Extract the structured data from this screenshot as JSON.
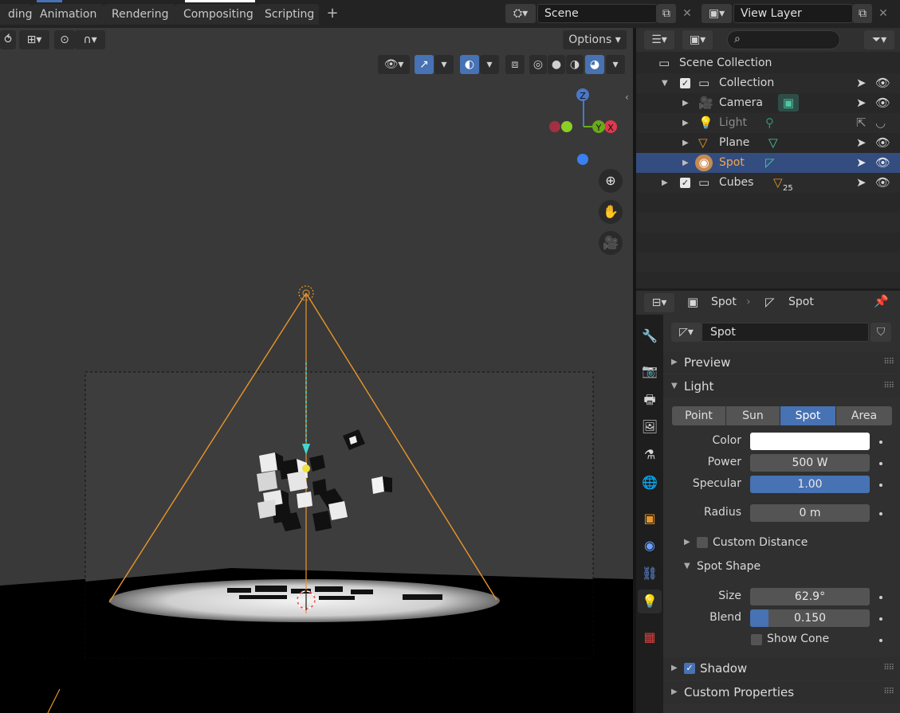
{
  "workspace_tabs": [
    "ding",
    "Animation",
    "Rendering",
    "Compositing",
    "Scripting"
  ],
  "add_tab_label": "+",
  "scene": {
    "label": "Scene",
    "close": "✕"
  },
  "view_layer": {
    "label": "View Layer",
    "close": "✕"
  },
  "viewport": {
    "options_label": "Options",
    "gizmo_axes": {
      "x": "X",
      "y": "Y",
      "z": "Z"
    },
    "colors": {
      "background": "#393939",
      "cone": "#e8962a",
      "selected": "#e8962a",
      "ground": "#000000"
    }
  },
  "outliner": {
    "search_placeholder": "",
    "scene_collection": "Scene Collection",
    "rows": [
      {
        "label": "Collection",
        "type": "collection"
      },
      {
        "label": "Camera",
        "type": "camera"
      },
      {
        "label": "Light",
        "type": "light",
        "dim": true
      },
      {
        "label": "Plane",
        "type": "mesh"
      },
      {
        "label": "Spot",
        "type": "light",
        "selected": true
      },
      {
        "label": "Cubes",
        "type": "collection",
        "badge": "25"
      }
    ]
  },
  "properties": {
    "breadcrumb_object": "Spot",
    "breadcrumb_data": "Spot",
    "datablock_name": "Spot",
    "panels": {
      "preview": "Preview",
      "light": "Light",
      "custom_distance": "Custom Distance",
      "spot_shape": "Spot Shape",
      "shadow": "Shadow",
      "custom_properties": "Custom Properties"
    },
    "light_types": [
      "Point",
      "Sun",
      "Spot",
      "Area"
    ],
    "active_light_type": "Spot",
    "fields": {
      "color_label": "Color",
      "power_label": "Power",
      "power_value": "500 W",
      "specular_label": "Specular",
      "specular_value": "1.00",
      "radius_label": "Radius",
      "radius_value": "0 m",
      "size_label": "Size",
      "size_value": "62.9°",
      "blend_label": "Blend",
      "blend_value": "0.150",
      "blend_fraction": 0.15,
      "show_cone_label": "Show Cone"
    },
    "color_value": "#ffffff",
    "accent": "#4772b3"
  }
}
